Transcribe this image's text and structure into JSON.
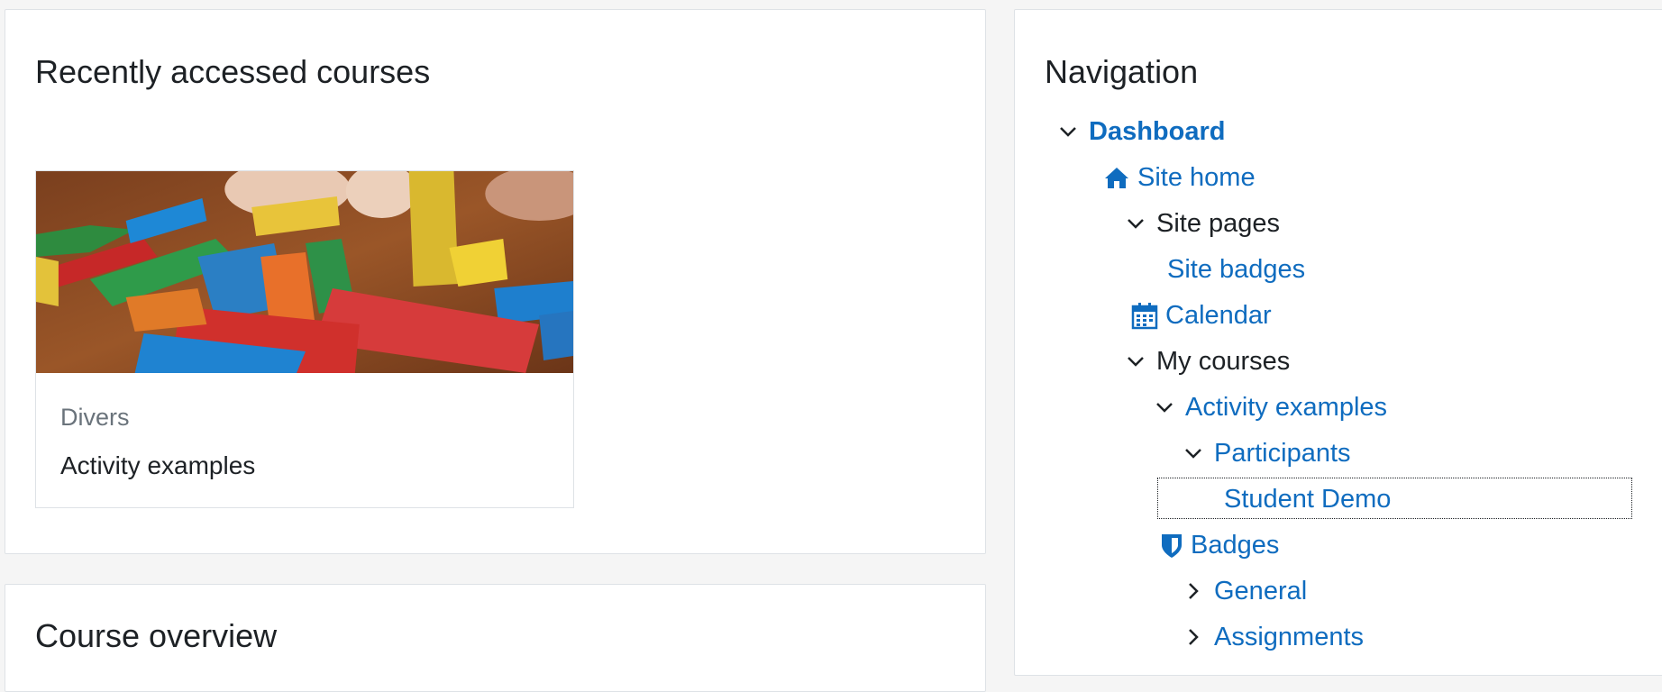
{
  "recent": {
    "title": "Recently accessed courses",
    "course": {
      "category": "Divers",
      "name": "Activity examples"
    }
  },
  "overview": {
    "title": "Course overview"
  },
  "navigation": {
    "title": "Navigation",
    "items": [
      {
        "label": "Dashboard",
        "icon": "chevron-down-icon",
        "link": true,
        "bold": true
      },
      {
        "label": "Site home",
        "icon": "home-icon",
        "link": true
      },
      {
        "label": "Site pages",
        "icon": "chevron-down-icon",
        "link": false
      },
      {
        "label": "Site badges",
        "icon": "",
        "link": true
      },
      {
        "label": "Calendar",
        "icon": "calendar-icon",
        "link": true
      },
      {
        "label": "My courses",
        "icon": "chevron-down-icon",
        "link": false
      },
      {
        "label": "Activity examples",
        "icon": "chevron-down-icon",
        "link": true
      },
      {
        "label": "Participants",
        "icon": "chevron-down-icon",
        "link": true
      },
      {
        "label": "Student Demo",
        "icon": "",
        "link": true,
        "focused": true
      },
      {
        "label": "Badges",
        "icon": "shield-icon",
        "link": true
      },
      {
        "label": "General",
        "icon": "chevron-right-icon",
        "link": true
      },
      {
        "label": "Assignments",
        "icon": "chevron-right-icon",
        "link": true
      }
    ]
  },
  "colors": {
    "link": "#0f6cbf",
    "text": "#1d2125",
    "muted": "#6a737b",
    "border": "#dee2e6",
    "background": "#f5f5f5"
  }
}
